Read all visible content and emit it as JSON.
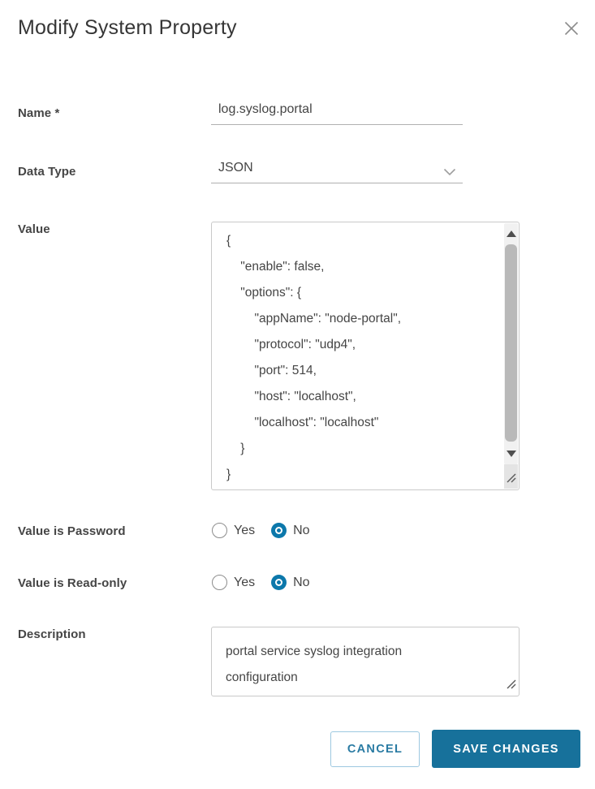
{
  "dialog": {
    "title": "Modify System Property"
  },
  "fields": {
    "name": {
      "label": "Name *",
      "value": "log.syslog.portal"
    },
    "data_type": {
      "label": "Data Type",
      "value": "JSON"
    },
    "value": {
      "label": "Value",
      "content": "{\n    \"enable\": false,\n    \"options\": {\n        \"appName\": \"node-portal\",\n        \"protocol\": \"udp4\",\n        \"port\": 514,\n        \"host\": \"localhost\",\n        \"localhost\": \"localhost\"\n    }\n}"
    },
    "value_is_password": {
      "label": "Value is Password",
      "options": [
        "Yes",
        "No"
      ],
      "selected": "No"
    },
    "value_is_readonly": {
      "label": "Value is Read-only",
      "options": [
        "Yes",
        "No"
      ],
      "selected": "No"
    },
    "description": {
      "label": "Description",
      "value": "portal service syslog integration\nconfiguration"
    }
  },
  "buttons": {
    "cancel": "CANCEL",
    "save": "SAVE CHANGES"
  },
  "colors": {
    "accent_button": "#17719b",
    "radio_selected": "#0c78ab",
    "cancel_border": "#9dc8e0",
    "cancel_text": "#2a7ba3",
    "label_text": "#454545",
    "underline": "#b0b0b0",
    "box_border": "#c9c9c9",
    "scroll_thumb": "#b9b9b9",
    "scroll_track": "#f1f1f1"
  }
}
